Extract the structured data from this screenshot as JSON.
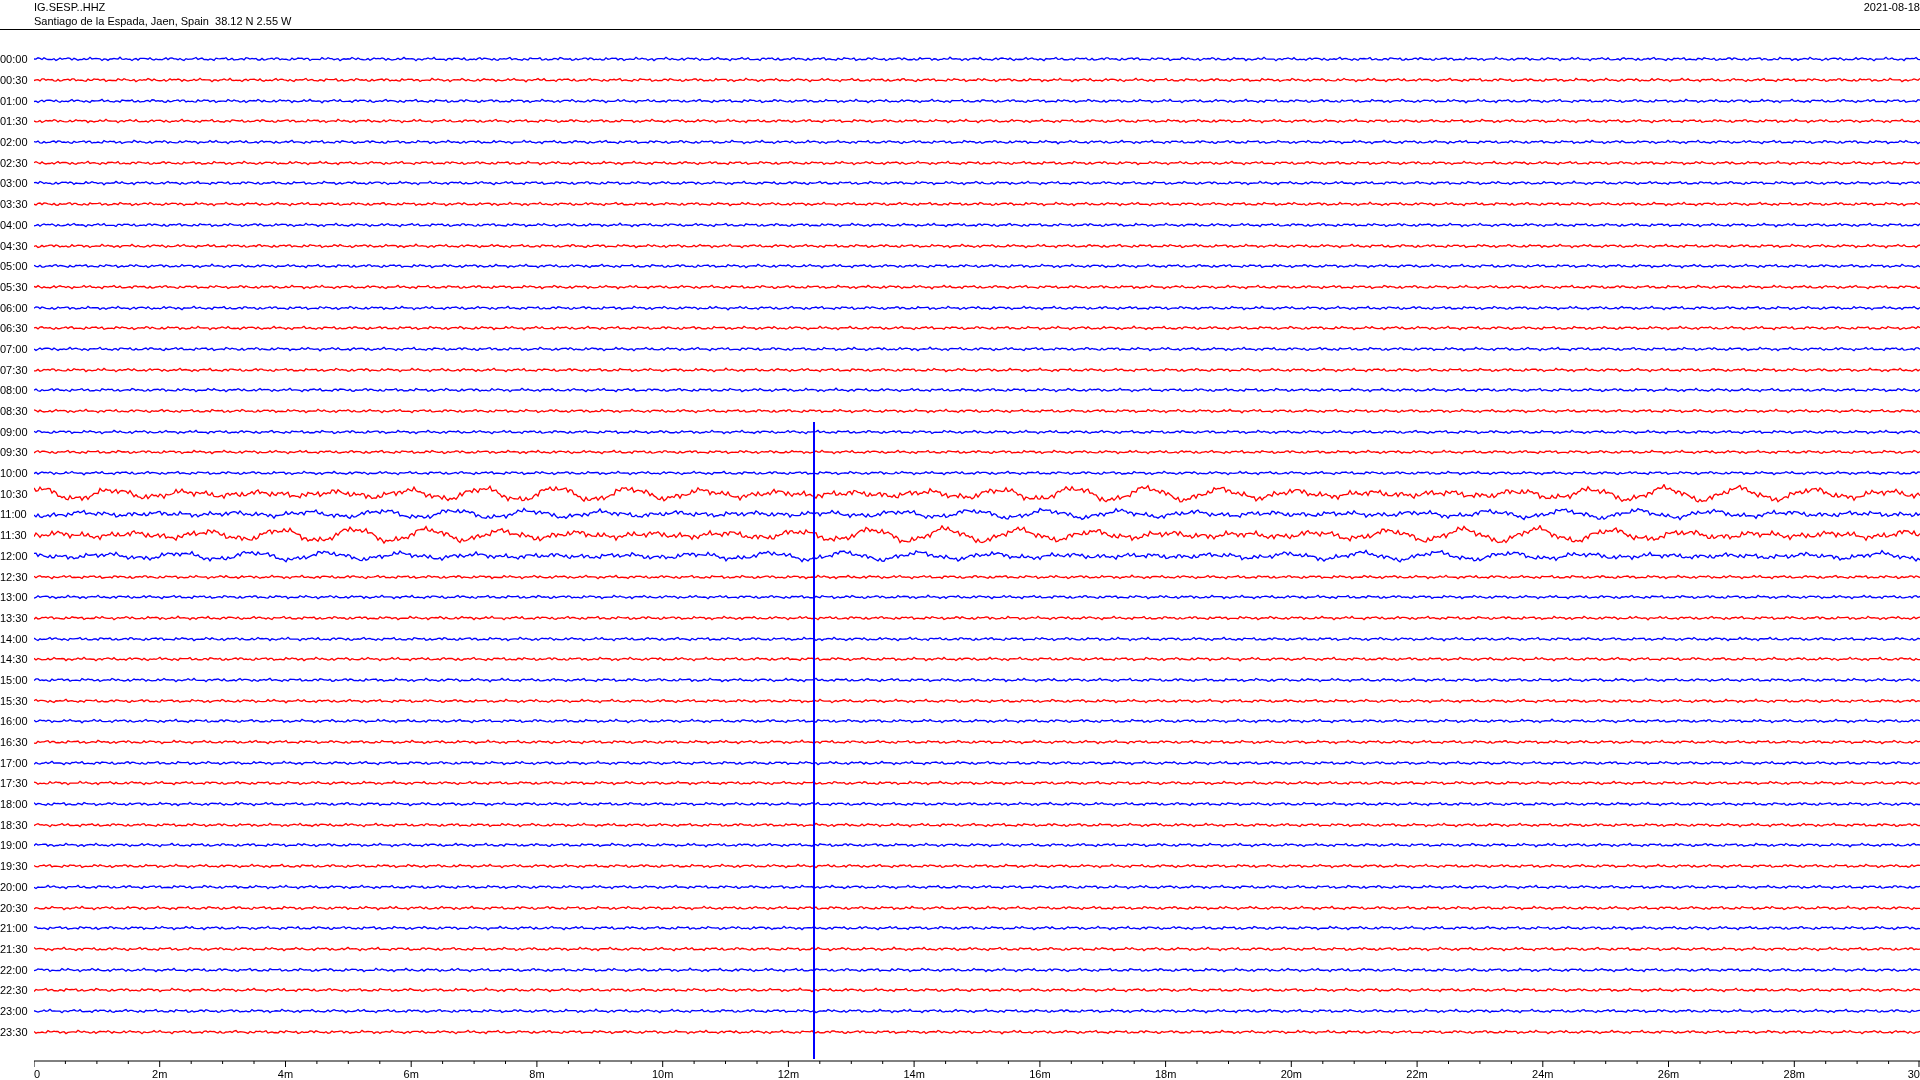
{
  "header": {
    "station": "IG.SESP..HHZ",
    "location": "Santiago de la Espada, Jaen, Spain  38.12 N 2.55 W",
    "date": "2021-08-18"
  },
  "traces": [
    {
      "time": "00:00",
      "color": "#0000ff",
      "kind": "quiet"
    },
    {
      "time": "00:30",
      "color": "#ff0000",
      "kind": "quiet"
    },
    {
      "time": "01:00",
      "color": "#0000ff",
      "kind": "quiet"
    },
    {
      "time": "01:30",
      "color": "#ff0000",
      "kind": "quiet"
    },
    {
      "time": "02:00",
      "color": "#0000ff",
      "kind": "quiet"
    },
    {
      "time": "02:30",
      "color": "#ff0000",
      "kind": "quiet"
    },
    {
      "time": "03:00",
      "color": "#0000ff",
      "kind": "quiet"
    },
    {
      "time": "03:30",
      "color": "#ff0000",
      "kind": "quiet"
    },
    {
      "time": "04:00",
      "color": "#0000ff",
      "kind": "quiet"
    },
    {
      "time": "04:30",
      "color": "#ff0000",
      "kind": "quiet"
    },
    {
      "time": "05:00",
      "color": "#0000ff",
      "kind": "quiet"
    },
    {
      "time": "05:30",
      "color": "#ff0000",
      "kind": "quiet"
    },
    {
      "time": "06:00",
      "color": "#0000ff",
      "kind": "quiet"
    },
    {
      "time": "06:30",
      "color": "#ff0000",
      "kind": "quiet"
    },
    {
      "time": "07:00",
      "color": "#0000ff",
      "kind": "quiet"
    },
    {
      "time": "07:30",
      "color": "#ff0000",
      "kind": "quiet"
    },
    {
      "time": "08:00",
      "color": "#0000ff",
      "kind": "quiet"
    },
    {
      "time": "08:30",
      "color": "#ff0000",
      "kind": "quiet"
    },
    {
      "time": "09:00",
      "color": "#0000ff",
      "kind": "quiet"
    },
    {
      "time": "09:30",
      "color": "#ff0000",
      "kind": "quiet"
    },
    {
      "time": "10:00",
      "color": "#0000ff",
      "kind": "quiet"
    },
    {
      "time": "10:30",
      "color": "#ff0000",
      "kind": "strong"
    },
    {
      "time": "11:00",
      "color": "#0000ff",
      "kind": "moderate"
    },
    {
      "time": "11:30",
      "color": "#ff0000",
      "kind": "strong"
    },
    {
      "time": "12:00",
      "color": "#0000ff",
      "kind": "moderate"
    },
    {
      "time": "12:30",
      "color": "#ff0000",
      "kind": "quiet"
    },
    {
      "time": "13:00",
      "color": "#0000ff",
      "kind": "quiet"
    },
    {
      "time": "13:30",
      "color": "#ff0000",
      "kind": "quiet"
    },
    {
      "time": "14:00",
      "color": "#0000ff",
      "kind": "quiet"
    },
    {
      "time": "14:30",
      "color": "#ff0000",
      "kind": "quiet"
    },
    {
      "time": "15:00",
      "color": "#0000ff",
      "kind": "quiet"
    },
    {
      "time": "15:30",
      "color": "#ff0000",
      "kind": "quiet"
    },
    {
      "time": "16:00",
      "color": "#0000ff",
      "kind": "quiet"
    },
    {
      "time": "16:30",
      "color": "#ff0000",
      "kind": "quiet"
    },
    {
      "time": "17:00",
      "color": "#0000ff",
      "kind": "quiet"
    },
    {
      "time": "17:30",
      "color": "#ff0000",
      "kind": "quiet"
    },
    {
      "time": "18:00",
      "color": "#0000ff",
      "kind": "quiet"
    },
    {
      "time": "18:30",
      "color": "#ff0000",
      "kind": "quiet"
    },
    {
      "time": "19:00",
      "color": "#0000ff",
      "kind": "quiet"
    },
    {
      "time": "19:30",
      "color": "#ff0000",
      "kind": "quiet"
    },
    {
      "time": "20:00",
      "color": "#0000ff",
      "kind": "quiet"
    },
    {
      "time": "20:30",
      "color": "#ff0000",
      "kind": "quiet"
    },
    {
      "time": "21:00",
      "color": "#0000ff",
      "kind": "quiet"
    },
    {
      "time": "21:30",
      "color": "#ff0000",
      "kind": "quiet"
    },
    {
      "time": "22:00",
      "color": "#0000ff",
      "kind": "quiet"
    },
    {
      "time": "22:30",
      "color": "#ff0000",
      "kind": "quiet"
    },
    {
      "time": "23:00",
      "color": "#0000ff",
      "kind": "quiet"
    },
    {
      "time": "23:30",
      "color": "#ff0000",
      "kind": "quiet"
    }
  ],
  "x_axis": {
    "ticks": [
      "0",
      "2m",
      "4m",
      "6m",
      "8m",
      "10m",
      "12m",
      "14m",
      "16m",
      "18m",
      "20m",
      "22m",
      "24m",
      "26m",
      "28m",
      "30"
    ]
  }
}
